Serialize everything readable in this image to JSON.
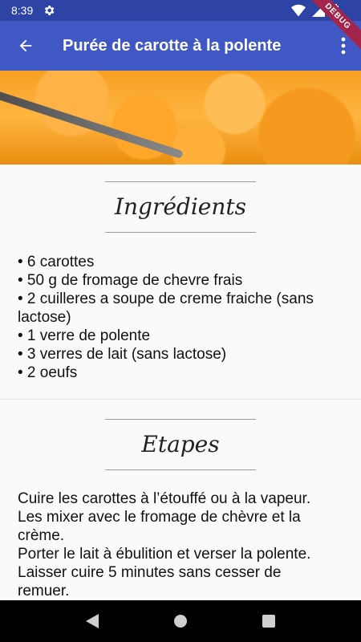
{
  "status_bar": {
    "time": "8:39",
    "icons": [
      "gear-icon",
      "wifi-icon",
      "signal-icon",
      "battery-icon"
    ]
  },
  "debug_banner": "DEBUG",
  "app_bar": {
    "title": "Purée de carotte à la polente",
    "back_icon": "arrow-back-icon",
    "menu_icon": "more-vert-icon",
    "color": "#3f58c4"
  },
  "ingredients": {
    "title": "Ingrédients",
    "items": [
      "• 6 carottes",
      "• 50 g de fromage de chevre frais",
      "• 2 cuilleres a soupe de creme fraiche (sans",
      "lactose)",
      "• 1 verre de polente",
      "• 3 verres de lait (sans lactose)",
      "• 2 oeufs"
    ]
  },
  "steps": {
    "title": "Etapes",
    "lines": [
      "Cuire les carottes à l’étouffé ou à la vapeur.",
      "Les mixer avec le fromage de chèvre et la",
      "crème.",
      "Porter le lait à ébulition et verser la polente.",
      "Laisser cuire 5 minutes sans cesser de",
      "remuer."
    ]
  },
  "nav_bar": {
    "buttons": [
      "back-triangle-icon",
      "home-circle-icon",
      "recents-square-icon"
    ]
  }
}
